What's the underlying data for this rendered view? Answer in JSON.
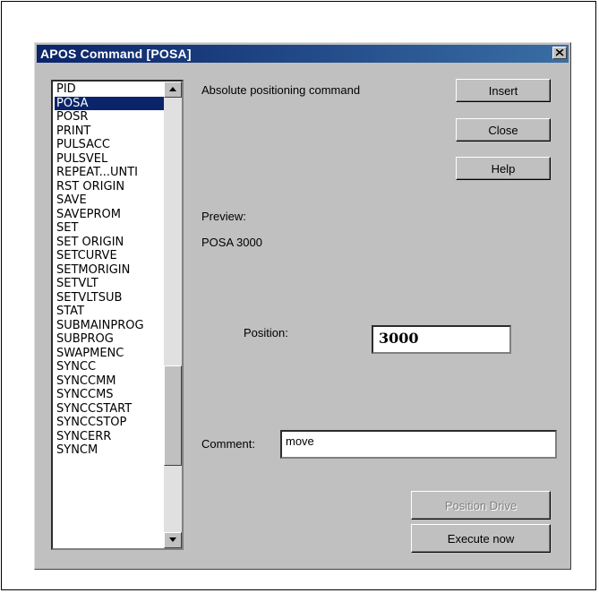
{
  "window": {
    "title": "APOS Command [POSA]"
  },
  "commands": {
    "items": [
      "PID",
      "POSA",
      "POSR",
      "PRINT",
      "PULSACC",
      "PULSVEL",
      "REPEAT...UNTI",
      "RST ORIGIN",
      "SAVE",
      "SAVEPROM",
      "SET",
      "SET ORIGIN",
      "SETCURVE",
      "SETMORIGIN",
      "SETVLT",
      "SETVLTSUB",
      "STAT",
      "SUBMAINPROG",
      "SUBPROG",
      "SWAPMENC",
      "SYNCC",
      "SYNCCMM",
      "SYNCCMS",
      "SYNCCSTART",
      "SYNCCSTOP",
      "SYNCERR",
      "SYNCM"
    ],
    "selected": "POSA"
  },
  "description": "Absolute positioning command",
  "preview": {
    "label": "Preview:",
    "text": "POSA 3000"
  },
  "position": {
    "label": "Position:",
    "value": "3000"
  },
  "comment": {
    "label": "Comment:",
    "value": "move"
  },
  "buttons": {
    "insert": "Insert",
    "close": "Close",
    "help": "Help",
    "position_drive": "Position Drive",
    "execute_now": "Execute now"
  },
  "icons": {
    "close": "close-icon",
    "scroll_up": "arrow-up-icon",
    "scroll_down": "arrow-down-icon"
  },
  "colors": {
    "titlebar": "#0a246a",
    "selection": "#0a246a",
    "dialog_bg": "#c0c0c0"
  }
}
